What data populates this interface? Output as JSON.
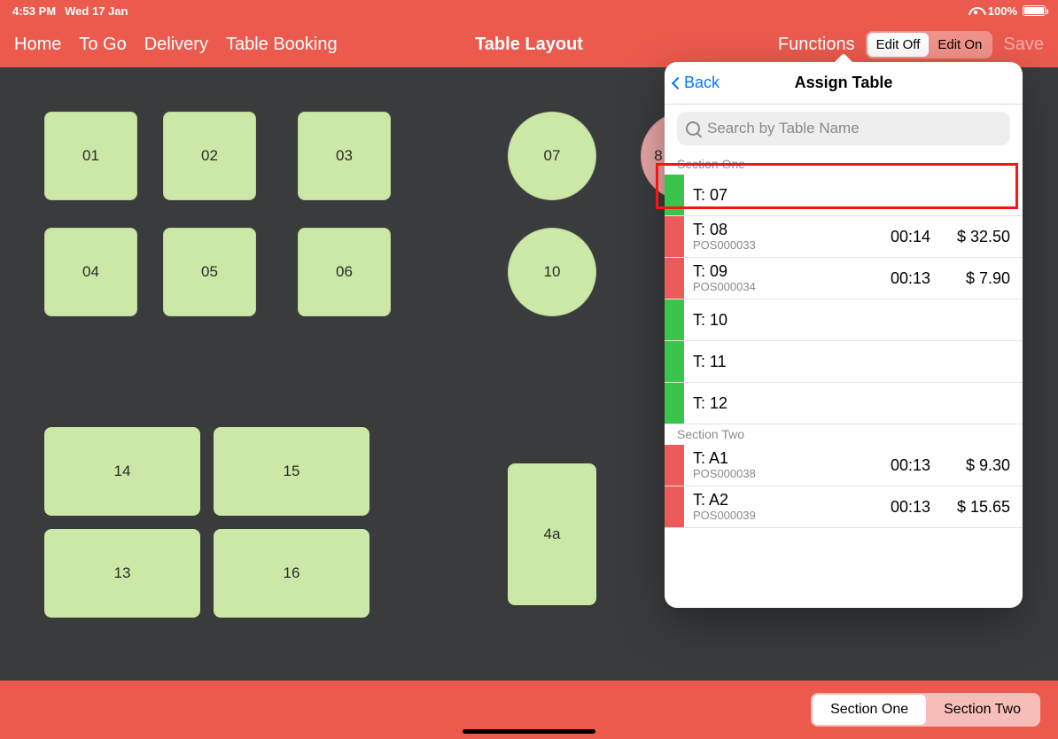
{
  "statusbar": {
    "time": "4:53 PM",
    "date": "Wed 17 Jan",
    "battery_pct": "100%"
  },
  "nav": {
    "links": [
      "Home",
      "To Go",
      "Delivery",
      "Table Booking"
    ],
    "title": "Table Layout",
    "functions": "Functions",
    "edit_off": "Edit Off",
    "edit_on": "Edit On",
    "save": "Save"
  },
  "tables": {
    "t01": "01",
    "t02": "02",
    "t03": "03",
    "t04": "04",
    "t05": "05",
    "t06": "06",
    "t07": "07",
    "t10": "10",
    "t8partial": "8",
    "t14": "14",
    "t15": "15",
    "t13": "13",
    "t16": "16",
    "t4a": "4a"
  },
  "popover": {
    "back": "Back",
    "title": "Assign Table",
    "search_placeholder": "Search by Table Name",
    "section_one": "Section One",
    "section_two": "Section Two",
    "rows": {
      "r07": {
        "name": "T: 07"
      },
      "r08": {
        "name": "T: 08",
        "sub": "POS000033",
        "timer": "00:14",
        "amount": "$ 32.50"
      },
      "r09": {
        "name": "T: 09",
        "sub": "POS000034",
        "timer": "00:13",
        "amount": "$ 7.90"
      },
      "r10": {
        "name": "T: 10"
      },
      "r11": {
        "name": "T: 11"
      },
      "r12": {
        "name": "T: 12"
      },
      "rA1": {
        "name": "T: A1",
        "sub": "POS000038",
        "timer": "00:13",
        "amount": "$ 9.30"
      },
      "rA2": {
        "name": "T: A2",
        "sub": "POS000039",
        "timer": "00:13",
        "amount": "$ 15.65"
      }
    }
  },
  "bottom": {
    "section_one": "Section One",
    "section_two": "Section Two"
  }
}
